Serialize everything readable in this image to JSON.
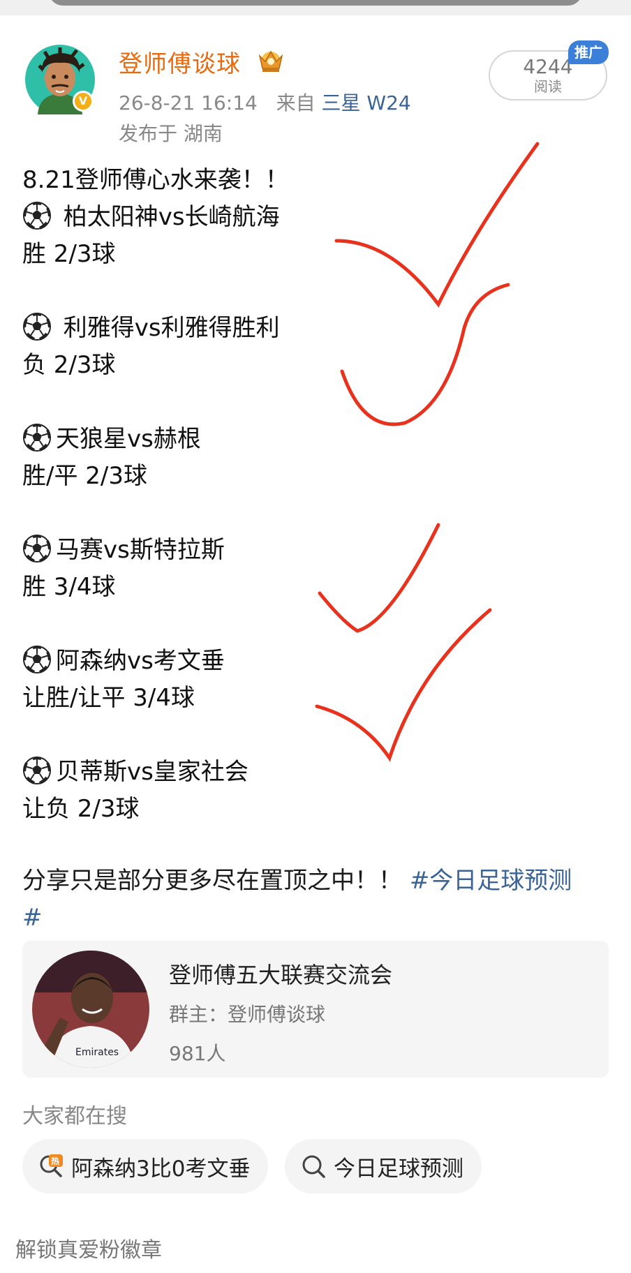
{
  "author": {
    "name": "登师傅谈球",
    "timestamp": "26-8-21 16:14",
    "source_prefix": "来自",
    "device": "三星 W24",
    "location": "发布于 湖南",
    "avatar_icon": "cartoon-man-avatar",
    "verified_icon": "verified-badge",
    "badge_icon": "crown-icon"
  },
  "stats": {
    "read_count": "4244",
    "read_label": "阅读",
    "promo_label": "推广"
  },
  "post": {
    "intro": "8.21登师傅心水来袭！！",
    "matches": [
      {
        "teams": " 柏太阳神vs长崎航海",
        "tip": " 胜  2/3球"
      },
      {
        "teams": " 利雅得vs利雅得胜利",
        "tip": " 负  2/3球"
      },
      {
        "teams": "天狼星vs赫根",
        "tip": "胜/平  2/3球"
      },
      {
        "teams": "马赛vs斯特拉斯",
        "tip": "胜 3/4球"
      },
      {
        "teams": "阿森纳vs考文垂",
        "tip": "让胜/让平 3/4球"
      },
      {
        "teams": "贝蒂斯vs皇家社会",
        "tip": "让负 2/3球"
      }
    ],
    "closing_text": "分享只是部分更多尽在置顶之中！！",
    "hashtag_a": "#今日足球预测",
    "hashtag_b": "#",
    "annotation_color": "#e8321e"
  },
  "group_card": {
    "name": "登师傅五大联赛交流会",
    "owner": "群主：登师傅谈球",
    "members": "981人",
    "avatar_icon": "player-photo"
  },
  "search": {
    "title": "大家都在搜",
    "chips": [
      {
        "label": "阿森纳3比0考文垂",
        "icon": "hot-search-icon"
      },
      {
        "label": "今日足球预测",
        "icon": "search-icon"
      }
    ]
  },
  "footer": {
    "unlock_text": "解锁真爱粉徽章"
  }
}
